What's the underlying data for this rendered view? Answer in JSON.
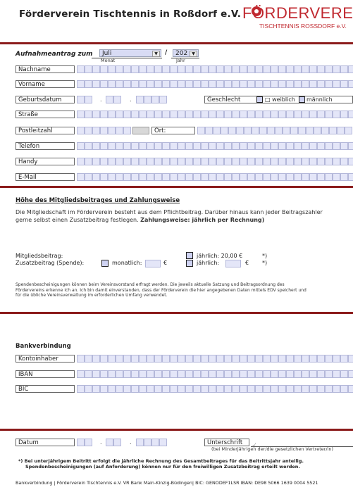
{
  "header": {
    "title": "Förderverein Tischtennis in Roßdorf e.V.",
    "logo_main": "FÖRDERVEREIN",
    "logo_sub": "TISCHTENNIS ROSSDORF e.V."
  },
  "application": {
    "label": "Aufnahmeantrag zum",
    "month_value": "Juli",
    "month_caption": "Monat",
    "separator": "/",
    "year_value": "202",
    "year_caption": "Jahr"
  },
  "fields": {
    "nachname": "Nachname",
    "vorname": "Vorname",
    "geburtsdatum": "Geburtsdatum",
    "geschlecht": "Geschlecht",
    "weiblich": "□ weiblich",
    "maennlich": "männlich",
    "strasse": "Straße",
    "plz": "Postleitzahl",
    "ort": "Ort:",
    "telefon": "Telefon",
    "handy": "Handy",
    "email": "E-Mail",
    "dot": "."
  },
  "beitrag": {
    "heading": "Höhe des Mitgliedsbeitrages und Zahlungsweise",
    "para_line1": "Die Mitgliedschaft im Förderverein besteht aus dem Pflichtbeitrag. Darüber hinaus kann jeder Beitragszahler",
    "para_line2_plain": "gerne selbst einen Zusatzbeitrag festlegen. ",
    "para_line2_bold": "Zahlungsweise: jährlich per Rechnung)",
    "mitgliedsbeitrag": "Mitgliedsbeitrag:",
    "zusatzbeitrag": "Zusatzbeitrag (Spende):",
    "monatlich": "monatlich:",
    "euro": "€",
    "jaehrlich_fix": "jährlich: 20,00 €",
    "jaehrlich": "jährlich:",
    "star": "*)",
    "fine1": "Spendenbescheinigungen können beim Vereinsvorstand erfragt werden. Die jeweils aktuelle Satzung und Beitragsordnung des",
    "fine2": "Fördervereins erkenne ich an. Ich bin damit einverstanden, dass der Förderverein die hier angegebenen Daten mittels EDV speichert und",
    "fine3": "für die übliche Vereinsverwaltung im erforderlichen Umfang verwendet."
  },
  "bank": {
    "heading": "Bankverbindung",
    "kontoinhaber": "Kontoinhaber",
    "iban": "IBAN",
    "bic": "BIC"
  },
  "signature": {
    "datum": "Datum",
    "unterschrift": "Unterschrift",
    "check": "√",
    "note": "(bei Minderjährigen der/die gesetzlichen Vertreter/in)"
  },
  "footnote": {
    "line1": "*)  Bei unterjährigem Beitritt erfolgt die jährliche Rechnung des Gesamtbeitrages für das Beitrittsjahr anteilig.",
    "line2": "Spendenbescheinigungen (auf Anforderung) können nur für den freiwilligen Zusatzbeitrag erteilt werden."
  },
  "footer": {
    "text": "Bankverbindung | Förderverein Tischtennis e.V. VR Bank Main-Kinzig-Büdingen| BIC: GENODEF1LSR IBAN: DE98 5066 1639  0004 5521"
  }
}
